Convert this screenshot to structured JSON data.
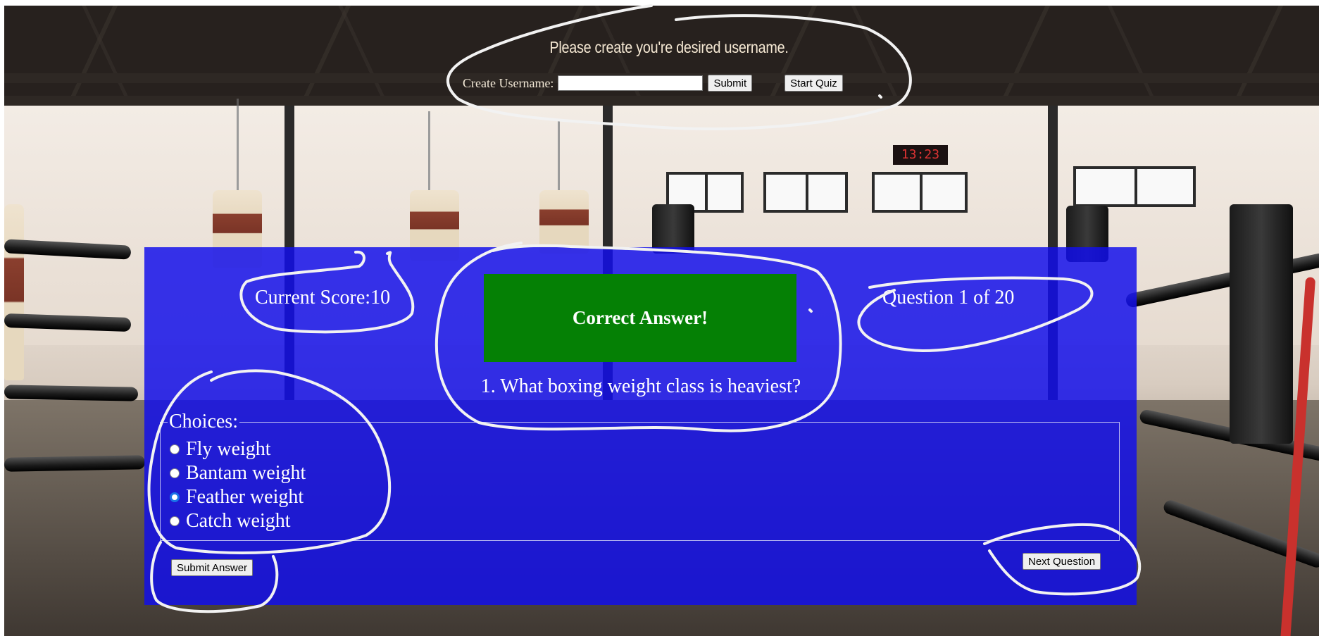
{
  "header": {
    "title": "Please create you're desired username.",
    "username_label": "Create Username:",
    "username_value": "",
    "submit_label": "Submit",
    "start_quiz_label": "Start Quiz"
  },
  "quiz": {
    "score_label": "Current Score:10",
    "feedback": "Correct Answer!",
    "question_counter": "Question 1 of 20",
    "question": "1. What boxing weight class is heaviest?",
    "choices_legend": "Choices:",
    "choices": [
      {
        "label": "Fly weight",
        "selected": false
      },
      {
        "label": "Bantam weight",
        "selected": false
      },
      {
        "label": "Feather weight",
        "selected": true
      },
      {
        "label": "Catch weight",
        "selected": false
      }
    ],
    "submit_answer_label": "Submit Answer",
    "next_question_label": "Next Question"
  },
  "background": {
    "clock_text": "13:23"
  },
  "colors": {
    "panel": "#120eeb",
    "feedback_bg": "#058005",
    "annotation": "#f2f2f2"
  }
}
